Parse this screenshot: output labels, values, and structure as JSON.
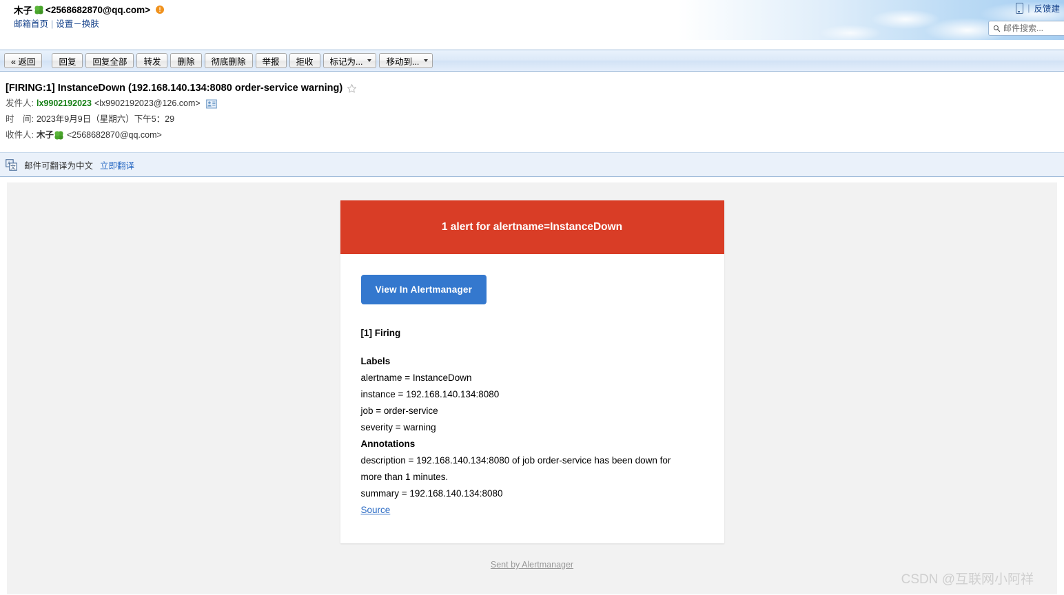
{
  "header": {
    "account_name": "木子",
    "account_email": "<2568682870@qq.com>",
    "warning_badge": "!",
    "links": {
      "home": "邮箱首页",
      "separator": "|",
      "settings": "设置",
      "dash": "－",
      "skin": "换肤"
    },
    "right": {
      "mobile_icon": "mobile-phone-icon",
      "divider": "|",
      "feedback": "反馈建"
    },
    "search": {
      "placeholder": "邮件搜索...",
      "value": "",
      "icon": "search-icon"
    }
  },
  "toolbar": {
    "buttons": [
      {
        "label": "« 返回",
        "caret": false
      },
      {
        "label": "回复",
        "caret": false
      },
      {
        "label": "回复全部",
        "caret": false
      },
      {
        "label": "转发",
        "caret": false
      },
      {
        "label": "删除",
        "caret": false
      },
      {
        "label": "彻底删除",
        "caret": false
      },
      {
        "label": "举报",
        "caret": false
      },
      {
        "label": "拒收",
        "caret": false
      },
      {
        "label": "标记为...",
        "caret": true
      },
      {
        "label": "移动到...",
        "caret": true
      }
    ]
  },
  "mail": {
    "subject": "[FIRING:1] InstanceDown (192.168.140.134:8080 order-service warning)",
    "star_icon": "star-outline-icon",
    "from": {
      "label": "发件人:",
      "name": "lx9902192023",
      "address": "<lx9902192023@126.com>",
      "card_icon": "contact-card-icon"
    },
    "time": {
      "label": "时　间:",
      "value": "2023年9月9日（星期六）下午5：29"
    },
    "to": {
      "label": "收件人:",
      "name": "木子",
      "address": "<2568682870@qq.com>"
    }
  },
  "translate": {
    "icon": "translate-icon",
    "text": "邮件可翻译为中文",
    "link": "立即翻译"
  },
  "alert": {
    "banner_title": "1 alert for alertname=InstanceDown",
    "banner_color": "#d93d26",
    "button_label": "View In Alertmanager",
    "button_color": "#3478ce",
    "firing_title": "[1] Firing",
    "labels_title": "Labels",
    "labels": [
      "alertname = InstanceDown",
      "instance = 192.168.140.134:8080",
      "job = order-service",
      "severity = warning"
    ],
    "annotations_title": "Annotations",
    "annotations": [
      "description = 192.168.140.134:8080 of job order-service has been down for more than 1 minutes.",
      "summary = 192.168.140.134:8080"
    ],
    "source_link": "Source",
    "footer": "Sent by Alertmanager"
  },
  "watermark": "CSDN @互联网小阿祥"
}
